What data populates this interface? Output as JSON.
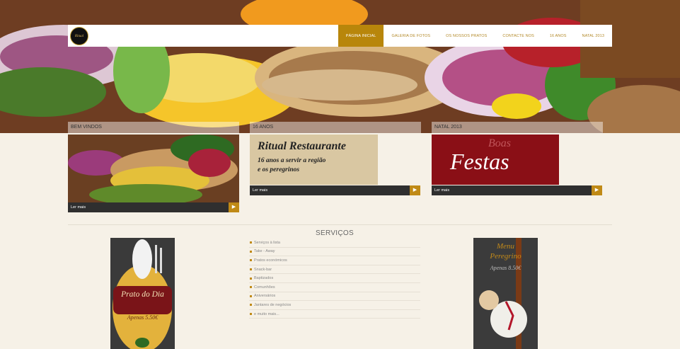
{
  "logo": {
    "text": "Ritual"
  },
  "nav": {
    "items": [
      {
        "label": "PÁGINA INICIAL",
        "active": true
      },
      {
        "label": "GALERIA DE FOTOS",
        "active": false
      },
      {
        "label": "OS NOSSOS PRATOS",
        "active": false
      },
      {
        "label": "CONTACTE NOS",
        "active": false
      },
      {
        "label": "16 ANOS",
        "active": false
      },
      {
        "label": "NATAL 2013",
        "active": false
      }
    ]
  },
  "cards": [
    {
      "title": "BEM VINDOS",
      "link": "Ler mais"
    },
    {
      "title": "16 ANOS",
      "link": "Ler mais",
      "image_title": "Ritual Restaurante",
      "image_sub1": "16 anos a servir a região",
      "image_sub2": "e os peregrinos"
    },
    {
      "title": "NATAL 2013",
      "link": "Ler mais",
      "image_title": "Boas",
      "image_sub": "Festas"
    }
  ],
  "services": {
    "title": "SERVIÇOS",
    "items": [
      "Serviços à lista",
      "Take - Away",
      "Pratos económicos",
      "Snack-bar",
      "Baptizados",
      "Comunhões",
      "Aniversários",
      "Jantares de negócios",
      "e muito mais..."
    ]
  },
  "posters": {
    "left": {
      "title": "Prato do Dia",
      "price": "Apenas 5.50€"
    },
    "right": {
      "title1": "Menu",
      "title2": "Peregrino",
      "price": "Apenas 8.50€"
    }
  },
  "colors": {
    "accent": "#b8860b",
    "arrow": "#c08a16",
    "background": "#f6f1e7",
    "bar": "#2f2f2f"
  }
}
